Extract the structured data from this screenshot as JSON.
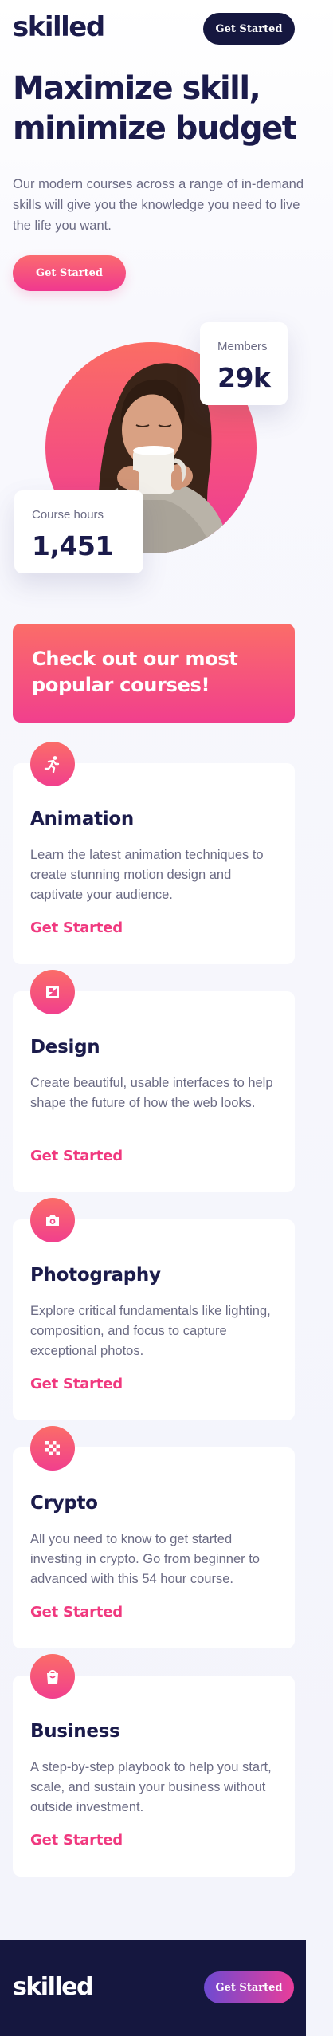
{
  "header": {
    "logo": "skilled",
    "cta_label": "Get Started"
  },
  "hero": {
    "title": "Maximize skill, minimize budget",
    "text": "Our modern courses across a range of in-demand skills will give you the knowledge you need to live the life you want.",
    "cta_label": "Get Started"
  },
  "stats": {
    "members_label": "Members",
    "members_value": "29k",
    "hours_label": "Course hours",
    "hours_value": "1,451"
  },
  "popular": {
    "title": "Check out our most popular courses!"
  },
  "courses": [
    {
      "title": "Animation",
      "icon": "running-figure-icon",
      "description": "Learn the latest animation techniques to create stunning motion design and captivate your audience.",
      "link_label": "Get Started"
    },
    {
      "title": "Design",
      "icon": "image-frame-icon",
      "description": "Create beautiful, usable interfaces to help shape the future of how the web looks.",
      "link_label": "Get Started"
    },
    {
      "title": "Photography",
      "icon": "camera-icon",
      "description": "Explore critical fundamentals like lighting, composition, and focus to capture exceptional photos.",
      "link_label": "Get Started"
    },
    {
      "title": "Crypto",
      "icon": "checker-pattern-icon",
      "description": "All you need to know to get started investing in crypto. Go from beginner to advanced with this 54 hour course.",
      "link_label": "Get Started"
    },
    {
      "title": "Business",
      "icon": "shopping-bag-icon",
      "description": "A step-by-step playbook to help you start, scale, and sustain your business without outside investment.",
      "link_label": "Get Started"
    }
  ],
  "footer": {
    "logo": "skilled",
    "cta_label": "Get Started"
  },
  "colors": {
    "navy": "#15173f",
    "heading": "#1b1b4b",
    "body_text": "#6b6b84",
    "accent_pink": "#f0397f",
    "accent_coral": "#fb6d68",
    "accent_purple": "#6e4ad1"
  }
}
